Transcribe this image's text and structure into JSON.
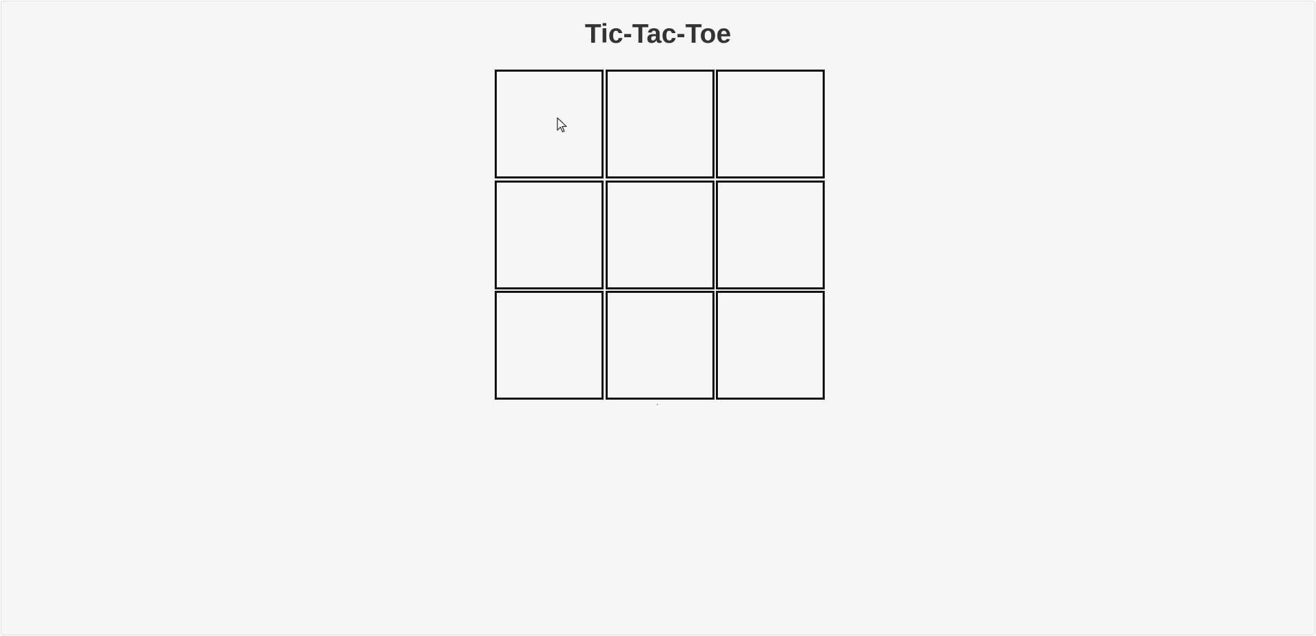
{
  "game": {
    "title": "Tic-Tac-Toe",
    "status_text": "",
    "board": [
      [
        "",
        "",
        ""
      ],
      [
        "",
        "",
        ""
      ],
      [
        "",
        "",
        ""
      ]
    ]
  },
  "icons": {
    "cursor": "mouse-pointer-icon"
  },
  "colors": {
    "background": "#f6f6f6",
    "grid_line": "#111111",
    "title": "#333333"
  }
}
